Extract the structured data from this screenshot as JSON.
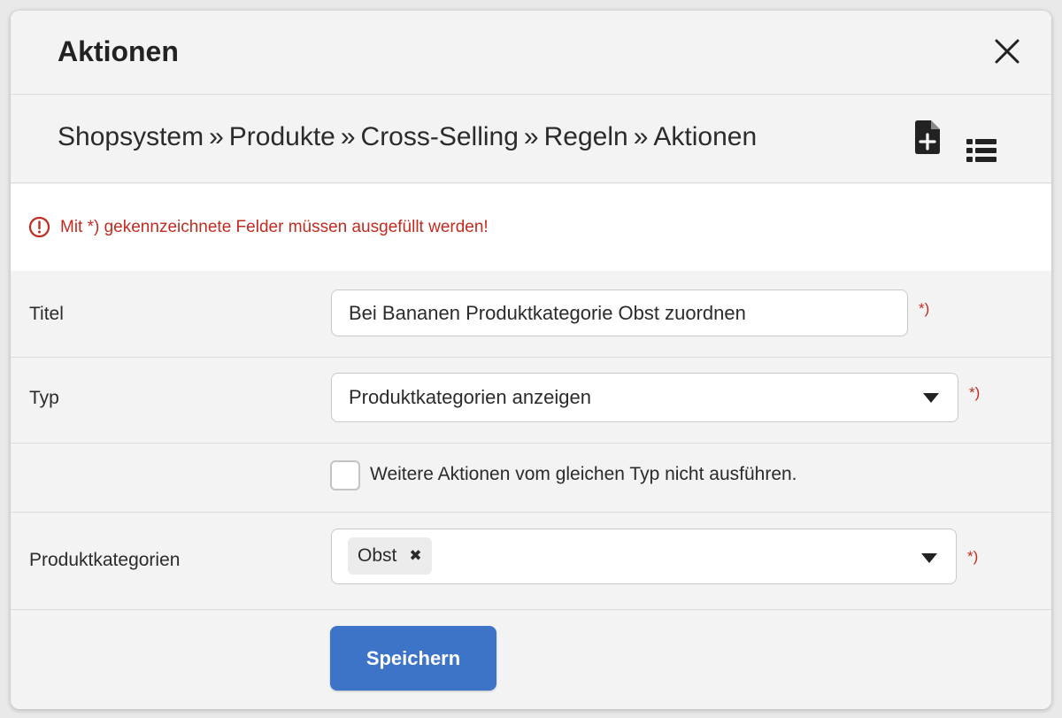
{
  "dialog": {
    "title": "Aktionen"
  },
  "breadcrumb": {
    "items": [
      "Shopsystem",
      "Produkte",
      "Cross-Selling",
      "Regeln",
      "Aktionen"
    ],
    "separator": "»"
  },
  "alert": {
    "text": "Mit *) gekennzeichnete Felder müssen ausgefüllt werden!"
  },
  "form": {
    "titel": {
      "label": "Titel",
      "value": "Bei Bananen Produktkategorie Obst zuordnen",
      "required_mark": "*)"
    },
    "typ": {
      "label": "Typ",
      "value": "Produktkategorien anzeigen",
      "required_mark": "*)"
    },
    "checkbox": {
      "label": "Weitere Aktionen vom gleichen Typ nicht ausführen.",
      "checked": false
    },
    "produktkategorien": {
      "label": "Produktkategorien",
      "tags": [
        "Obst"
      ],
      "tag_remove": "✖",
      "required_mark": "*)"
    },
    "save_label": "Speichern"
  },
  "icons": {
    "close": "close-icon",
    "new_document": "file-plus-icon",
    "list": "list-icon",
    "alert": "alert-circle-icon",
    "caret": "caret-down-icon"
  },
  "colors": {
    "accent": "#3d74c7",
    "error": "#c22b1f",
    "background": "#f3f3f3"
  }
}
